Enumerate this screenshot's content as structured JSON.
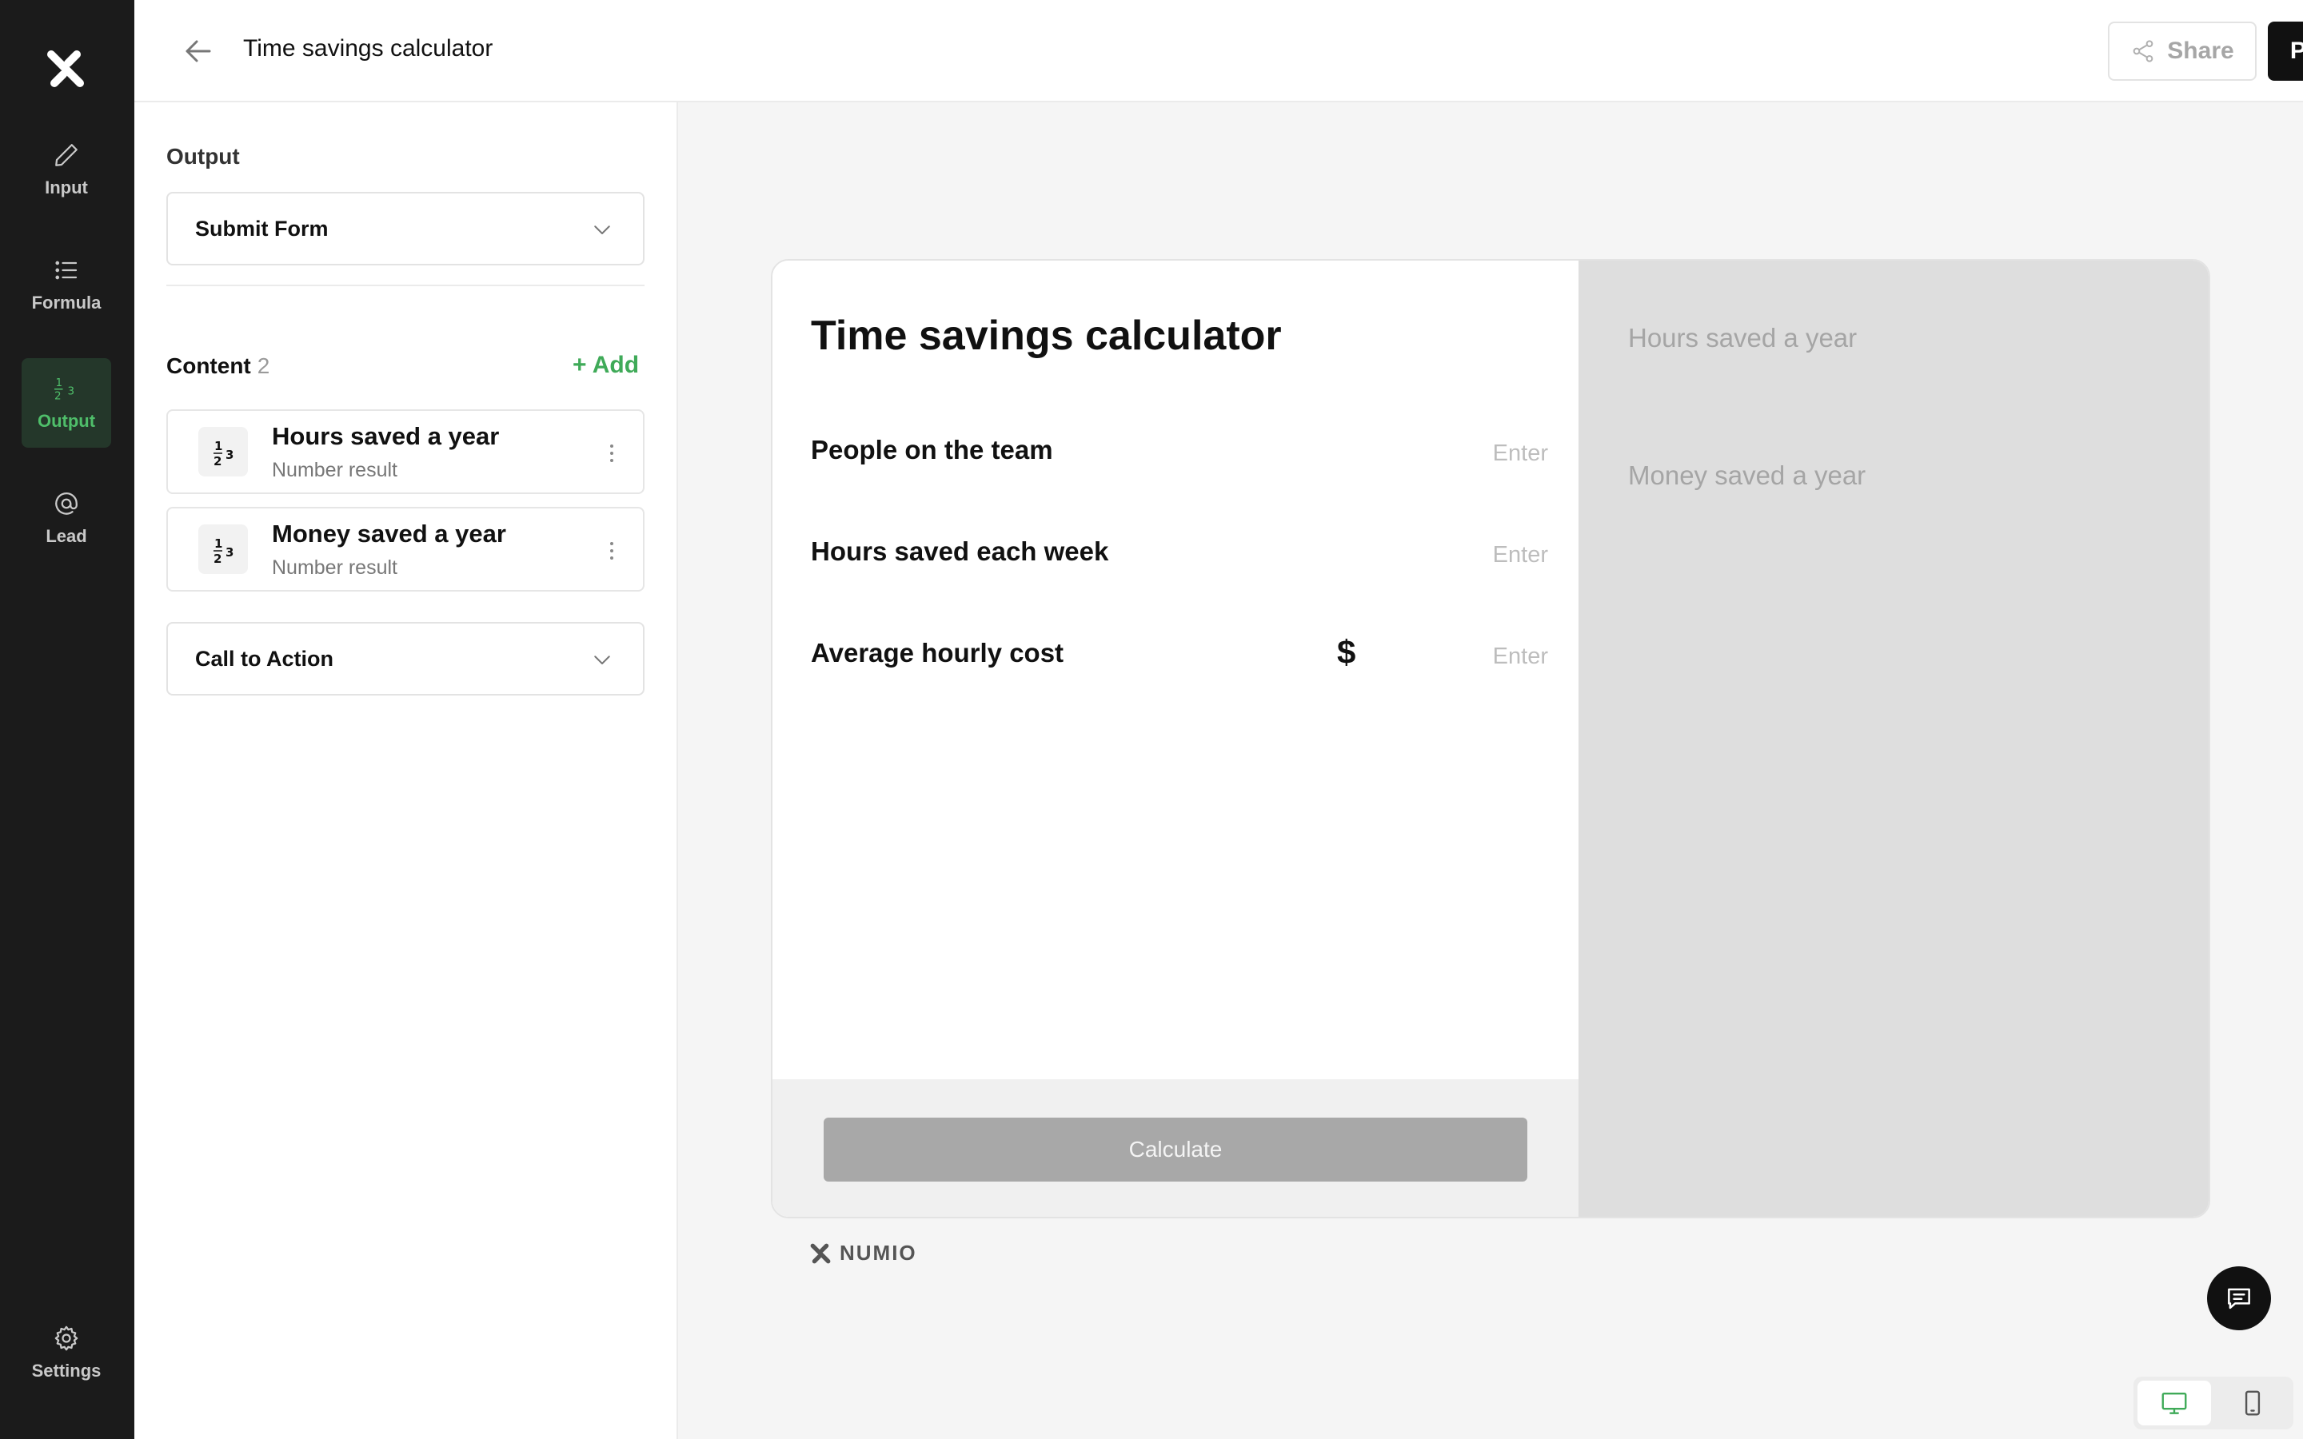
{
  "app": {
    "title": "Time savings calculator"
  },
  "colors": {
    "accent": "#3faa58",
    "rail_bg": "#1b1b1b",
    "rail_active_bg": "#24372a",
    "result_panel_bg": "#dedede",
    "calculate_button_bg": "#a8a8a8"
  },
  "rail": {
    "logo_icon": "numio-logo-icon",
    "items": [
      {
        "label": "Input",
        "icon": "pencil-icon"
      },
      {
        "label": "Formula",
        "icon": "list-icon"
      },
      {
        "label": "Output",
        "icon": "numbers-icon",
        "active": true
      },
      {
        "label": "Lead",
        "icon": "at-sign-icon"
      }
    ],
    "settings": {
      "label": "Settings",
      "icon": "gear-icon"
    }
  },
  "header": {
    "back_icon": "arrow-left-icon",
    "title": "Time savings calculator",
    "share_label": "Share",
    "share_icon": "share-icon",
    "publish_label": "Publish"
  },
  "panel": {
    "section_title": "Output",
    "output_select": {
      "value": "Submit Form"
    },
    "content_title": "Content",
    "content_count": "2",
    "add_label": "+ Add",
    "content_items": [
      {
        "name": "Hours saved a year",
        "type": "Number result",
        "icon": "numbers-icon"
      },
      {
        "name": "Money saved a year",
        "type": "Number result",
        "icon": "numbers-icon"
      }
    ],
    "cta_select": {
      "value": "Call to Action"
    }
  },
  "preview": {
    "title": "Time savings calculator",
    "fields": [
      {
        "label": "People on the team",
        "placeholder": "Enter"
      },
      {
        "label": "Hours saved each week",
        "placeholder": "Enter"
      },
      {
        "label": "Average hourly cost",
        "placeholder": "Enter",
        "prefix": "$"
      }
    ],
    "calculate_label": "Calculate",
    "results": [
      {
        "label": "Hours saved a year"
      },
      {
        "label": "Money saved a year"
      }
    ],
    "brand_text": "NUMIO"
  },
  "chat_icon": "chat-icon",
  "device_toggle": [
    {
      "icon": "desktop-icon",
      "active": true
    },
    {
      "icon": "mobile-icon",
      "active": false
    }
  ]
}
